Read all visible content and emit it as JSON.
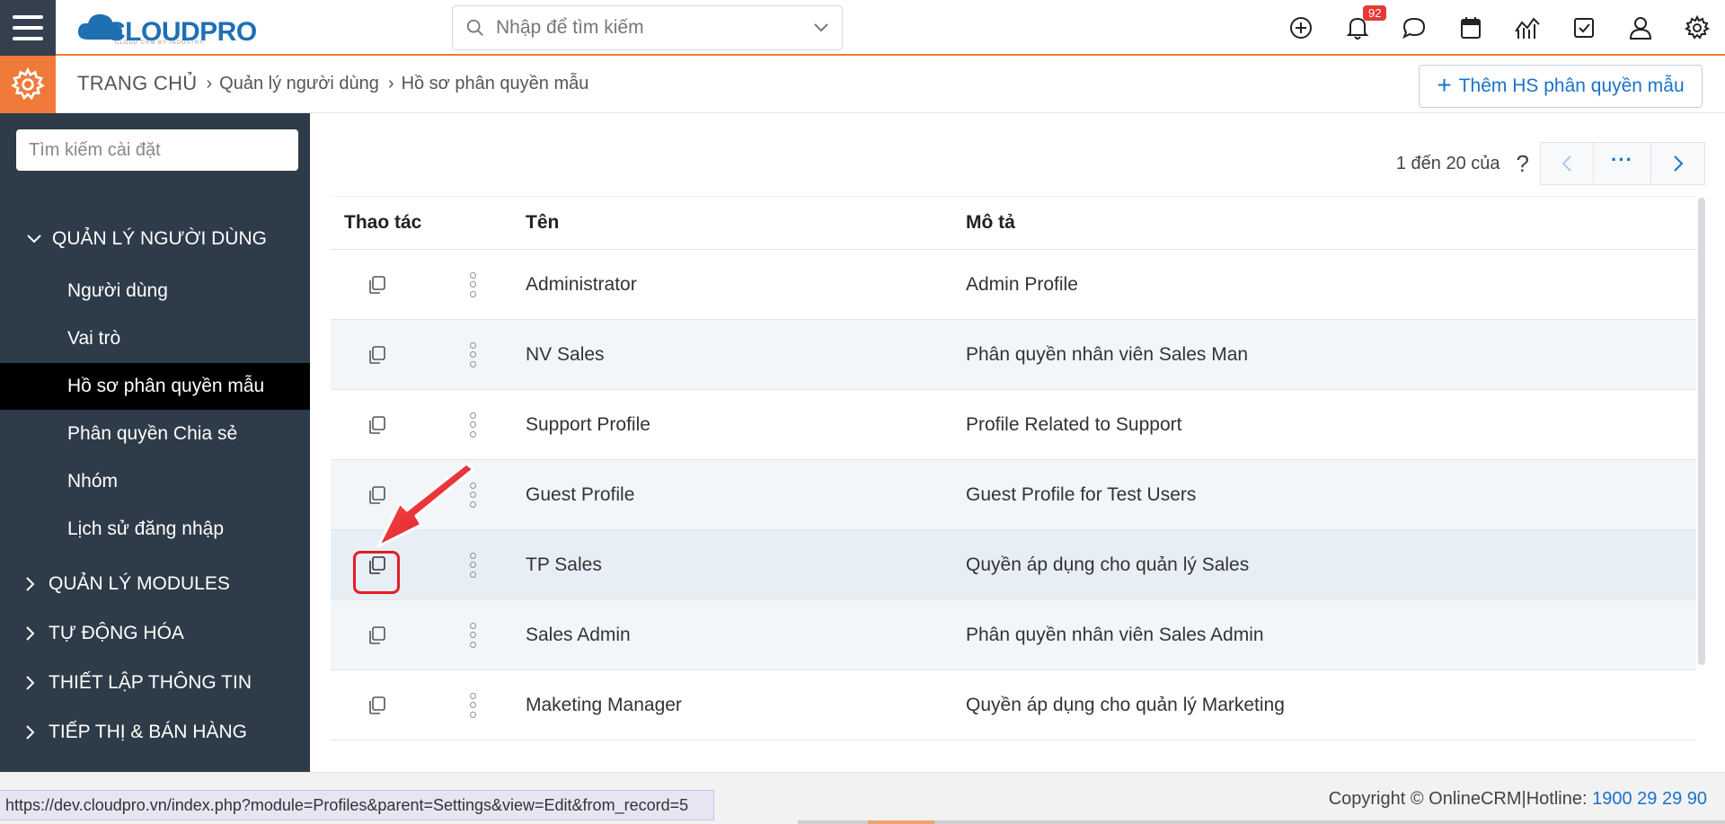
{
  "header": {
    "logo": {
      "prefix": "C",
      "main": "LOUDPRO",
      "tagline": "CLOUD CRM BY INDUSTRY"
    },
    "search_placeholder": "Nhập để tìm kiếm",
    "notification_count": "92",
    "icons": [
      "add-icon",
      "bell-icon",
      "chat-icon",
      "calendar-icon",
      "chart-icon",
      "checkbox-icon",
      "user-icon",
      "gear-icon"
    ]
  },
  "breadcrumb": {
    "home": "TRANG CHỦ",
    "level1": "Quản lý người dùng",
    "level2": "Hồ sơ phân quyền mẫu"
  },
  "add_button": "Thêm HS phân quyền mẫu",
  "sidebar": {
    "search_placeholder": "Tìm kiếm cài đặt",
    "section_user": "QUẢN LÝ NGƯỜI DÙNG",
    "items": [
      "Người dùng",
      "Vai trò",
      "Hồ sơ phân quyền mẫu",
      "Phân quyền Chia sẻ",
      "Nhóm",
      "Lịch sử đăng nhập"
    ],
    "active_item": "Hồ sơ phân quyền mẫu",
    "sections": [
      "QUẢN LÝ MODULES",
      "TỰ ĐỘNG HÓA",
      "THIẾT LẬP THÔNG TIN",
      "TIẾP THỊ & BÁN HÀNG"
    ]
  },
  "pager": {
    "info": "1 đến 20 của",
    "unknown": "?",
    "more": "···"
  },
  "table": {
    "headers": {
      "actions": "Thao tác",
      "name": "Tên",
      "description": "Mô tả"
    },
    "rows": [
      {
        "name": "Administrator",
        "description": "Admin Profile"
      },
      {
        "name": "NV Sales",
        "description": "Phân quyền nhân viên Sales Man"
      },
      {
        "name": "Support Profile",
        "description": "Profile Related to Support"
      },
      {
        "name": "Guest Profile",
        "description": "Guest Profile for Test Users"
      },
      {
        "name": "TP Sales",
        "description": "Quyền áp dụng cho quản lý Sales"
      },
      {
        "name": "Sales Admin",
        "description": "Phân quyền nhân viên Sales Admin"
      },
      {
        "name": "Maketing Manager",
        "description": "Quyền áp dụng cho quản lý Marketing"
      }
    ]
  },
  "footer": {
    "copyright": "Copyright © OnlineCRM",
    "hotline_label": "|Hotline: ",
    "hotline": "1900 29 29 90",
    "status_url": "https://dev.cloudpro.vn/index.php?module=Profiles&parent=Settings&view=Edit&from_record=5"
  },
  "colors": {
    "accent": "#f07a3a",
    "sidebar": "#2e3b48",
    "link": "#1a73c9",
    "highlight": "#e31e24"
  }
}
